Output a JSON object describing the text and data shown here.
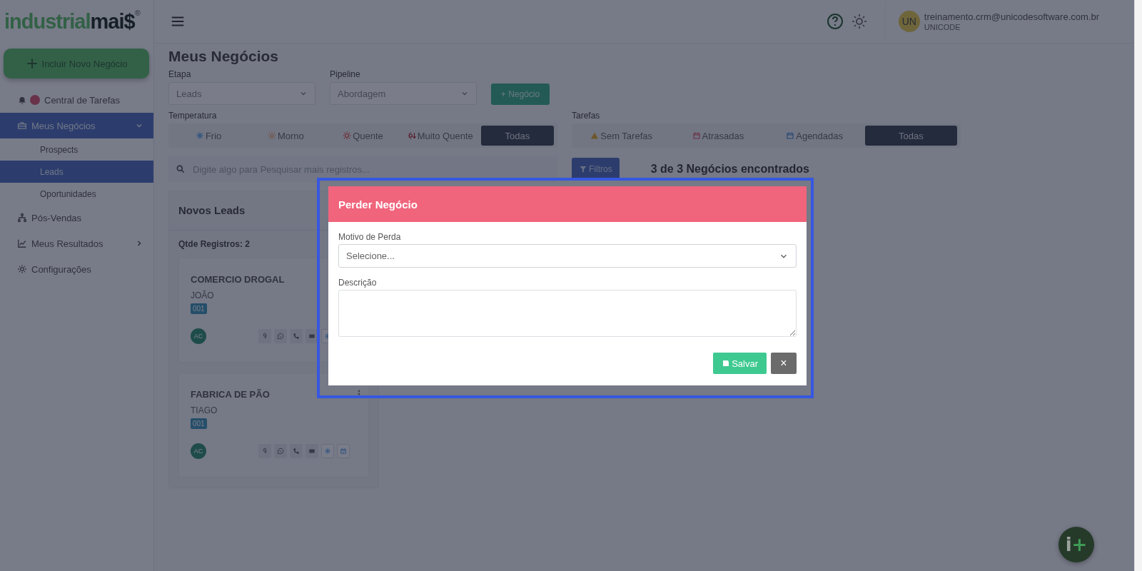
{
  "logo": {
    "first": "industrial",
    "second": "mai$",
    "mark": "®"
  },
  "sidebar": {
    "new_button": "Incluir Novo Negócio",
    "items": [
      {
        "label": "Central de Tarefas",
        "kind": "bell",
        "alert": true,
        "selected": false
      },
      {
        "label": "Meus Negócios",
        "kind": "briefcase",
        "selected": true,
        "expanded": true,
        "children": [
          {
            "label": "Prospects",
            "selected": false
          },
          {
            "label": "Leads",
            "selected": true
          },
          {
            "label": "Oportunidades",
            "selected": false
          }
        ]
      },
      {
        "label": "Pós-Vendas",
        "kind": "sitemap",
        "selected": false
      },
      {
        "label": "Meus Resultados",
        "kind": "chart",
        "selected": false,
        "expanded": false
      },
      {
        "label": "Configurações",
        "kind": "gear",
        "selected": false
      }
    ]
  },
  "header": {
    "user_initials": "UN",
    "user_email": "treinamento.crm@unicodesoftware.com.br",
    "company": "UNICODE"
  },
  "page_title": "Meus Negócios",
  "filters": {
    "etapa": {
      "label": "Etapa",
      "value": "Leads"
    },
    "pipeline": {
      "label": "Pipeline",
      "value": "Abordagem"
    },
    "new_deal_button": "+ Negócio",
    "temperature": {
      "label": "Temperatura",
      "options": [
        {
          "label": "Frio",
          "kind": "snow",
          "selected": false
        },
        {
          "label": "Morno",
          "kind": "sun-warm",
          "selected": false
        },
        {
          "label": "Quente",
          "kind": "sun-hot",
          "selected": false
        },
        {
          "label": "Muito Quente",
          "kind": "sun-very",
          "selected": false
        },
        {
          "label": "Todas",
          "selected": true
        }
      ]
    },
    "tasks": {
      "label": "Tarefas",
      "options": [
        {
          "label": "Sem Tarefas",
          "kind": "warning",
          "selected": false
        },
        {
          "label": "Atrasadas",
          "kind": "cal-late",
          "selected": false
        },
        {
          "label": "Agendadas",
          "kind": "cal-sched",
          "selected": false
        },
        {
          "label": "Todas",
          "selected": true
        }
      ]
    },
    "search_placeholder": "Digite algo para Pesquisar mais registros...",
    "filters_button": "Filtros",
    "result_count": "3 de 3 Negócios encontrados"
  },
  "column": {
    "title": "Novos Leads",
    "count": "Qtde Registros: 2",
    "cards": [
      {
        "company": "COMERCIO DROGAL",
        "contact": "JOÃO",
        "code": "001",
        "owner": "AC",
        "menu": false,
        "actions": [
          {
            "kind": "clip"
          },
          {
            "kind": "whatsapp"
          },
          {
            "kind": "phone"
          },
          {
            "kind": "mail"
          },
          {
            "kind": "snow"
          }
        ]
      },
      {
        "company": "FABRICA DE PÃO",
        "contact": "TIAGO",
        "code": "001",
        "owner": "AC",
        "menu": true,
        "actions": [
          {
            "kind": "clip"
          },
          {
            "kind": "whatsapp"
          },
          {
            "kind": "phone"
          },
          {
            "kind": "mail"
          },
          {
            "kind": "snow"
          },
          {
            "kind": "calendar"
          }
        ]
      }
    ]
  },
  "modal": {
    "title": "Perder Negócio",
    "reason_label": "Motivo de Perda",
    "reason_value": "Selecione...",
    "description_label": "Descrição",
    "save_button": "Salvar",
    "close_button": "×",
    "highlighted": true
  },
  "fab": {
    "letter": "i",
    "sign": "+"
  }
}
